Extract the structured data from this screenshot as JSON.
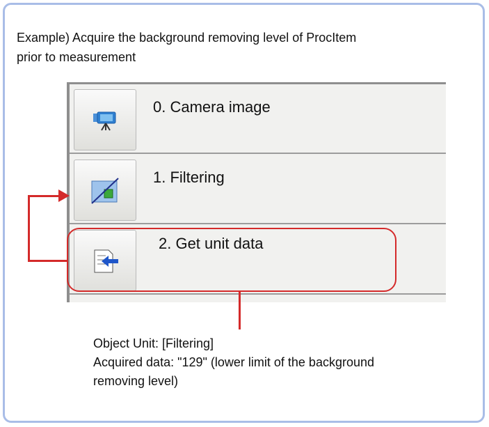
{
  "intro": {
    "line1": "Example) Acquire the background removing level of ProcItem",
    "line2": "prior to measurement"
  },
  "units": [
    {
      "label": "0. Camera image",
      "icon": "camera-icon"
    },
    {
      "label": "1. Filtering",
      "icon": "filter-icon"
    },
    {
      "label": "2. Get unit data",
      "icon": "get-unit-data-icon"
    }
  ],
  "note": {
    "line1": "Object Unit: [Filtering]",
    "line2": "Acquired data: \"129\" (lower limit of the background",
    "line3": "removing level)"
  },
  "colors": {
    "frame_border": "#a9bde7",
    "annotation_red": "#d42a2a",
    "list_background": "#f1f1ef"
  }
}
